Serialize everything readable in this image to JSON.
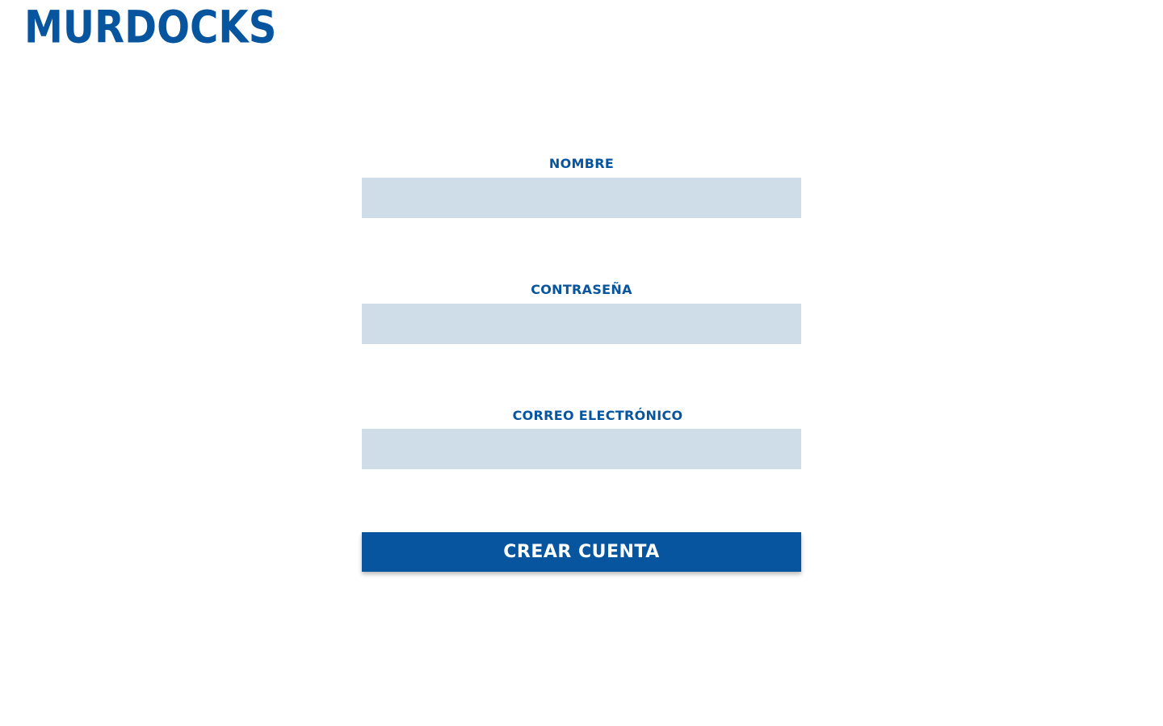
{
  "brand": {
    "logo_text": "MURDOCKS",
    "color": "#07559e"
  },
  "form": {
    "fields": [
      {
        "label": "NOMBRE",
        "value": "",
        "placeholder": ""
      },
      {
        "label": "CONTRASEÑA",
        "value": "",
        "placeholder": ""
      },
      {
        "label": "CORREO ELECTRÓNICO",
        "value": "",
        "placeholder": ""
      }
    ],
    "submit_label": "CREAR CUENTA",
    "input_background": "#cfdde9",
    "button_background": "#07559e"
  }
}
